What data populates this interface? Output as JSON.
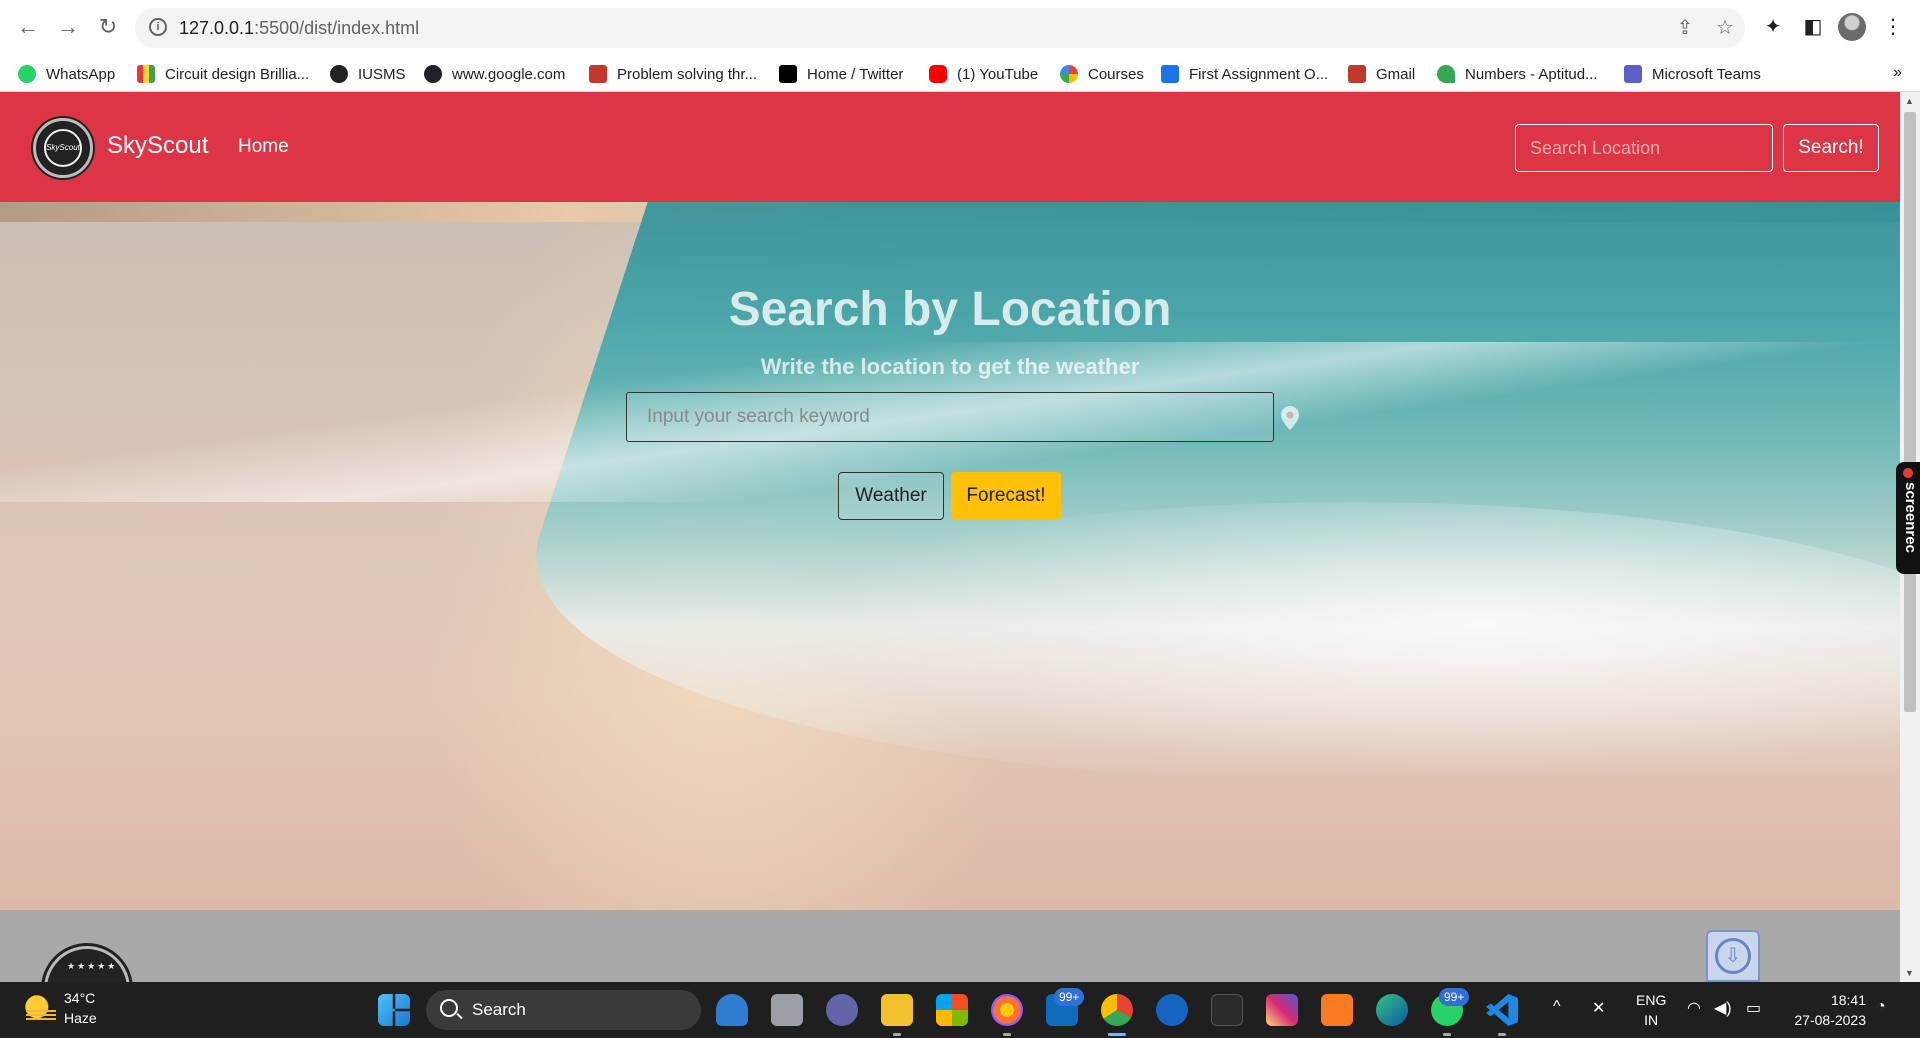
{
  "browser": {
    "url_host": "127.0.0.1",
    "url_rest": ":5500/dist/index.html",
    "bookmarks": [
      {
        "label": "WhatsApp",
        "color": "#25d366"
      },
      {
        "label": "Circuit design Brillia...",
        "color": "#e0a020"
      },
      {
        "label": "IUSMS",
        "color": "#202124"
      },
      {
        "label": "www.google.com",
        "color": "#202124"
      },
      {
        "label": "Problem solving thr...",
        "color": "#c0392b"
      },
      {
        "label": "Home / Twitter",
        "color": "#000000"
      },
      {
        "label": "(1) YouTube",
        "color": "#ff0000"
      },
      {
        "label": "Courses",
        "color": "#4285f4"
      },
      {
        "label": "First Assignment O...",
        "color": "#1a73e8"
      },
      {
        "label": "Gmail",
        "color": "#c0392b"
      },
      {
        "label": "Numbers - Aptitud...",
        "color": "#34a853"
      },
      {
        "label": "Microsoft Teams",
        "color": "#5b5fc7"
      }
    ],
    "more": "»"
  },
  "nav": {
    "brand": "SkyScout",
    "logo_text": "SkyScout",
    "home": "Home",
    "search_placeholder": "Search Location",
    "search_button": "Search!",
    "accent": "#dc3545"
  },
  "hero": {
    "title": "Search by Location",
    "subtitle": "Write the location to get the weather",
    "input_placeholder": "Input your search keyword",
    "weather_button": "Weather",
    "forecast_button": "Forecast!",
    "forecast_color": "#ffc107"
  },
  "screenrec": "screenrec",
  "taskbar": {
    "temp": "34°C",
    "condition": "Haze",
    "search_label": "Search",
    "badge_mail": "99+",
    "badge_whatsapp": "99+",
    "lang_1": "ENG",
    "lang_2": "IN",
    "time": "18:41",
    "date": "27-08-2023"
  }
}
